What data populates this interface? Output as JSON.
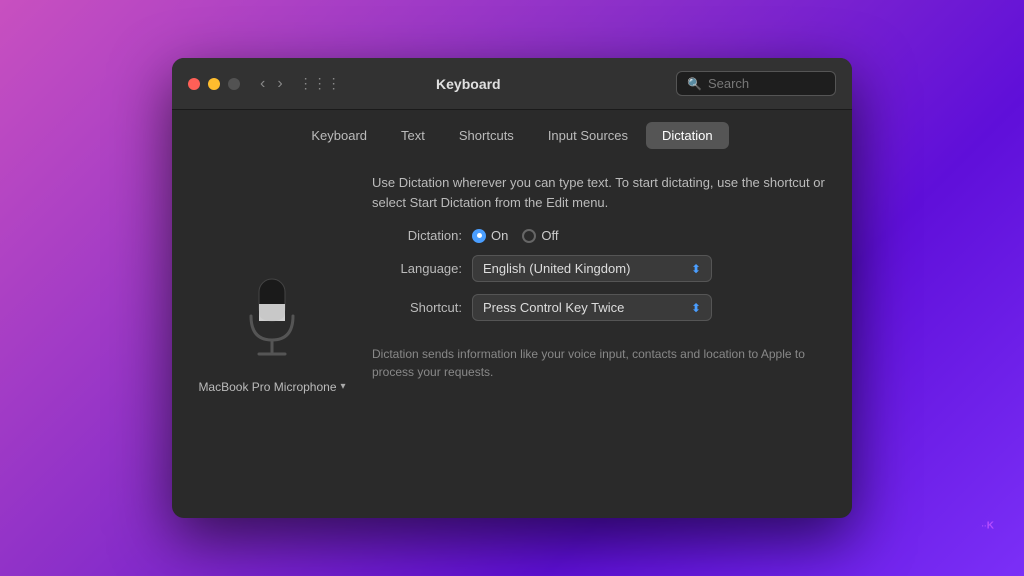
{
  "window": {
    "title": "Keyboard"
  },
  "titlebar": {
    "traffic_lights": [
      "close",
      "minimize",
      "maximize"
    ],
    "nav_back": "‹",
    "nav_forward": "›",
    "grid_icon": "⋮⋮⋮",
    "search_placeholder": "Search"
  },
  "tabs": [
    {
      "id": "keyboard",
      "label": "Keyboard",
      "active": false
    },
    {
      "id": "text",
      "label": "Text",
      "active": false
    },
    {
      "id": "shortcuts",
      "label": "Shortcuts",
      "active": false
    },
    {
      "id": "input-sources",
      "label": "Input Sources",
      "active": false
    },
    {
      "id": "dictation",
      "label": "Dictation",
      "active": true
    }
  ],
  "content": {
    "description": "Use Dictation wherever you can type text. To start dictating, use the shortcut or select Start Dictation from the Edit menu.",
    "microphone_label": "MacBook Pro Microphone",
    "settings": {
      "dictation": {
        "label": "Dictation:",
        "on_label": "On",
        "off_label": "Off",
        "value": "on"
      },
      "language": {
        "label": "Language:",
        "value": "English (United Kingdom)"
      },
      "shortcut": {
        "label": "Shortcut:",
        "value": "Press Control Key Twice"
      }
    },
    "privacy_text": "Dictation sends information like your voice input, contacts and location to Apple to process your requests."
  },
  "watermark": {
    "symbol": "·",
    "letter": "K"
  }
}
